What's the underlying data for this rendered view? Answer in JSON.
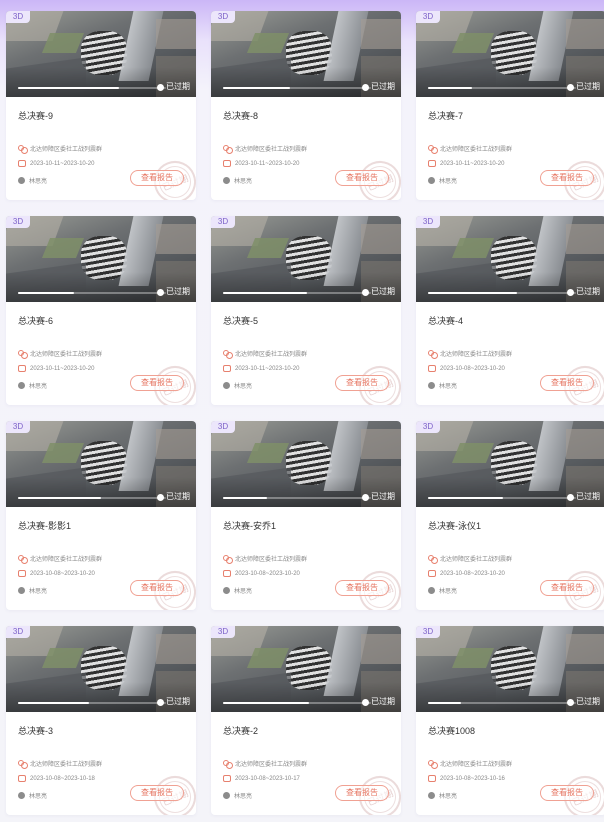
{
  "labels": {
    "badge": "3D",
    "status": "已过期",
    "report_button": "查看报告",
    "stamp": "已过期"
  },
  "colors": {
    "accent": "#e6735f",
    "badge": "#7d62c9"
  },
  "icons": [
    "people-icon",
    "calendar-icon",
    "user-avatar-icon"
  ],
  "cards": [
    {
      "title": "总决赛-9",
      "group": "北达师障区委社工战列震群",
      "dates": "2023-10-11~2023-10-20",
      "owner": "林思亮",
      "progress": 0.68
    },
    {
      "title": "总决赛-8",
      "group": "北达师障区委社工战列震群",
      "dates": "2023-10-11~2023-10-20",
      "owner": "林思亮",
      "progress": 0.45
    },
    {
      "title": "总决赛-7",
      "group": "北达师障区委社工战列震群",
      "dates": "2023-10-11~2023-10-20",
      "owner": "林思亮",
      "progress": 0.3
    },
    {
      "title": "总决赛-6",
      "group": "北达师障区委社工战列震群",
      "dates": "2023-10-11~2023-10-20",
      "owner": "林思亮",
      "progress": 0.38
    },
    {
      "title": "总决赛-5",
      "group": "北达师障区委社工战列震群",
      "dates": "2023-10-11~2023-10-20",
      "owner": "林思亮",
      "progress": 0.57
    },
    {
      "title": "总决赛-4",
      "group": "北达师障区委社工战列震群",
      "dates": "2023-10-08~2023-10-20",
      "owner": "林思亮",
      "progress": 0.6
    },
    {
      "title": "总决赛-影影1",
      "group": "北达师障区委社工战列震群",
      "dates": "2023-10-08~2023-10-20",
      "owner": "林思亮",
      "progress": 0.56
    },
    {
      "title": "总决赛-安乔1",
      "group": "北达师障区委社工战列震群",
      "dates": "2023-10-08~2023-10-20",
      "owner": "林思亮",
      "progress": 0.3
    },
    {
      "title": "总决赛-泳仪1",
      "group": "北达师障区委社工战列震群",
      "dates": "2023-10-08~2023-10-20",
      "owner": "林思亮",
      "progress": 0.51
    },
    {
      "title": "总决赛-3",
      "group": "北达师障区委社工战列震群",
      "dates": "2023-10-08~2023-10-18",
      "owner": "林思亮",
      "progress": 0.48
    },
    {
      "title": "总决赛-2",
      "group": "北达师障区委社工战列震群",
      "dates": "2023-10-08~2023-10-17",
      "owner": "林思亮",
      "progress": 0.58
    },
    {
      "title": "总决赛1008",
      "group": "北达师障区委社工战列震群",
      "dates": "2023-10-08~2023-10-16",
      "owner": "林思亮",
      "progress": 0.22
    }
  ]
}
